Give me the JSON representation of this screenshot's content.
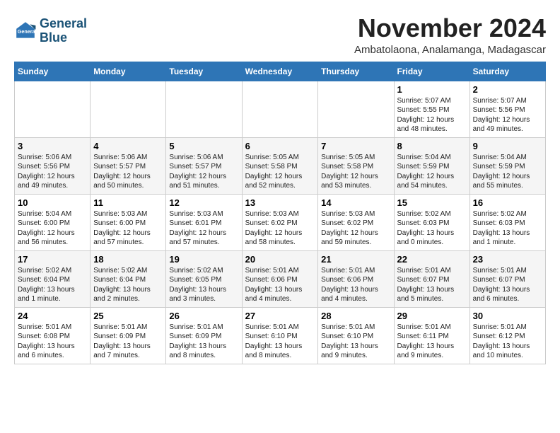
{
  "logo": {
    "line1": "General",
    "line2": "Blue"
  },
  "title": "November 2024",
  "subtitle": "Ambatolaona, Analamanga, Madagascar",
  "weekdays": [
    "Sunday",
    "Monday",
    "Tuesday",
    "Wednesday",
    "Thursday",
    "Friday",
    "Saturday"
  ],
  "weeks": [
    [
      {
        "day": "",
        "info": ""
      },
      {
        "day": "",
        "info": ""
      },
      {
        "day": "",
        "info": ""
      },
      {
        "day": "",
        "info": ""
      },
      {
        "day": "",
        "info": ""
      },
      {
        "day": "1",
        "info": "Sunrise: 5:07 AM\nSunset: 5:55 PM\nDaylight: 12 hours\nand 48 minutes."
      },
      {
        "day": "2",
        "info": "Sunrise: 5:07 AM\nSunset: 5:56 PM\nDaylight: 12 hours\nand 49 minutes."
      }
    ],
    [
      {
        "day": "3",
        "info": "Sunrise: 5:06 AM\nSunset: 5:56 PM\nDaylight: 12 hours\nand 49 minutes."
      },
      {
        "day": "4",
        "info": "Sunrise: 5:06 AM\nSunset: 5:57 PM\nDaylight: 12 hours\nand 50 minutes."
      },
      {
        "day": "5",
        "info": "Sunrise: 5:06 AM\nSunset: 5:57 PM\nDaylight: 12 hours\nand 51 minutes."
      },
      {
        "day": "6",
        "info": "Sunrise: 5:05 AM\nSunset: 5:58 PM\nDaylight: 12 hours\nand 52 minutes."
      },
      {
        "day": "7",
        "info": "Sunrise: 5:05 AM\nSunset: 5:58 PM\nDaylight: 12 hours\nand 53 minutes."
      },
      {
        "day": "8",
        "info": "Sunrise: 5:04 AM\nSunset: 5:59 PM\nDaylight: 12 hours\nand 54 minutes."
      },
      {
        "day": "9",
        "info": "Sunrise: 5:04 AM\nSunset: 5:59 PM\nDaylight: 12 hours\nand 55 minutes."
      }
    ],
    [
      {
        "day": "10",
        "info": "Sunrise: 5:04 AM\nSunset: 6:00 PM\nDaylight: 12 hours\nand 56 minutes."
      },
      {
        "day": "11",
        "info": "Sunrise: 5:03 AM\nSunset: 6:00 PM\nDaylight: 12 hours\nand 57 minutes."
      },
      {
        "day": "12",
        "info": "Sunrise: 5:03 AM\nSunset: 6:01 PM\nDaylight: 12 hours\nand 57 minutes."
      },
      {
        "day": "13",
        "info": "Sunrise: 5:03 AM\nSunset: 6:02 PM\nDaylight: 12 hours\nand 58 minutes."
      },
      {
        "day": "14",
        "info": "Sunrise: 5:03 AM\nSunset: 6:02 PM\nDaylight: 12 hours\nand 59 minutes."
      },
      {
        "day": "15",
        "info": "Sunrise: 5:02 AM\nSunset: 6:03 PM\nDaylight: 13 hours\nand 0 minutes."
      },
      {
        "day": "16",
        "info": "Sunrise: 5:02 AM\nSunset: 6:03 PM\nDaylight: 13 hours\nand 1 minute."
      }
    ],
    [
      {
        "day": "17",
        "info": "Sunrise: 5:02 AM\nSunset: 6:04 PM\nDaylight: 13 hours\nand 1 minute."
      },
      {
        "day": "18",
        "info": "Sunrise: 5:02 AM\nSunset: 6:04 PM\nDaylight: 13 hours\nand 2 minutes."
      },
      {
        "day": "19",
        "info": "Sunrise: 5:02 AM\nSunset: 6:05 PM\nDaylight: 13 hours\nand 3 minutes."
      },
      {
        "day": "20",
        "info": "Sunrise: 5:01 AM\nSunset: 6:06 PM\nDaylight: 13 hours\nand 4 minutes."
      },
      {
        "day": "21",
        "info": "Sunrise: 5:01 AM\nSunset: 6:06 PM\nDaylight: 13 hours\nand 4 minutes."
      },
      {
        "day": "22",
        "info": "Sunrise: 5:01 AM\nSunset: 6:07 PM\nDaylight: 13 hours\nand 5 minutes."
      },
      {
        "day": "23",
        "info": "Sunrise: 5:01 AM\nSunset: 6:07 PM\nDaylight: 13 hours\nand 6 minutes."
      }
    ],
    [
      {
        "day": "24",
        "info": "Sunrise: 5:01 AM\nSunset: 6:08 PM\nDaylight: 13 hours\nand 6 minutes."
      },
      {
        "day": "25",
        "info": "Sunrise: 5:01 AM\nSunset: 6:09 PM\nDaylight: 13 hours\nand 7 minutes."
      },
      {
        "day": "26",
        "info": "Sunrise: 5:01 AM\nSunset: 6:09 PM\nDaylight: 13 hours\nand 8 minutes."
      },
      {
        "day": "27",
        "info": "Sunrise: 5:01 AM\nSunset: 6:10 PM\nDaylight: 13 hours\nand 8 minutes."
      },
      {
        "day": "28",
        "info": "Sunrise: 5:01 AM\nSunset: 6:10 PM\nDaylight: 13 hours\nand 9 minutes."
      },
      {
        "day": "29",
        "info": "Sunrise: 5:01 AM\nSunset: 6:11 PM\nDaylight: 13 hours\nand 9 minutes."
      },
      {
        "day": "30",
        "info": "Sunrise: 5:01 AM\nSunset: 6:12 PM\nDaylight: 13 hours\nand 10 minutes."
      }
    ]
  ]
}
